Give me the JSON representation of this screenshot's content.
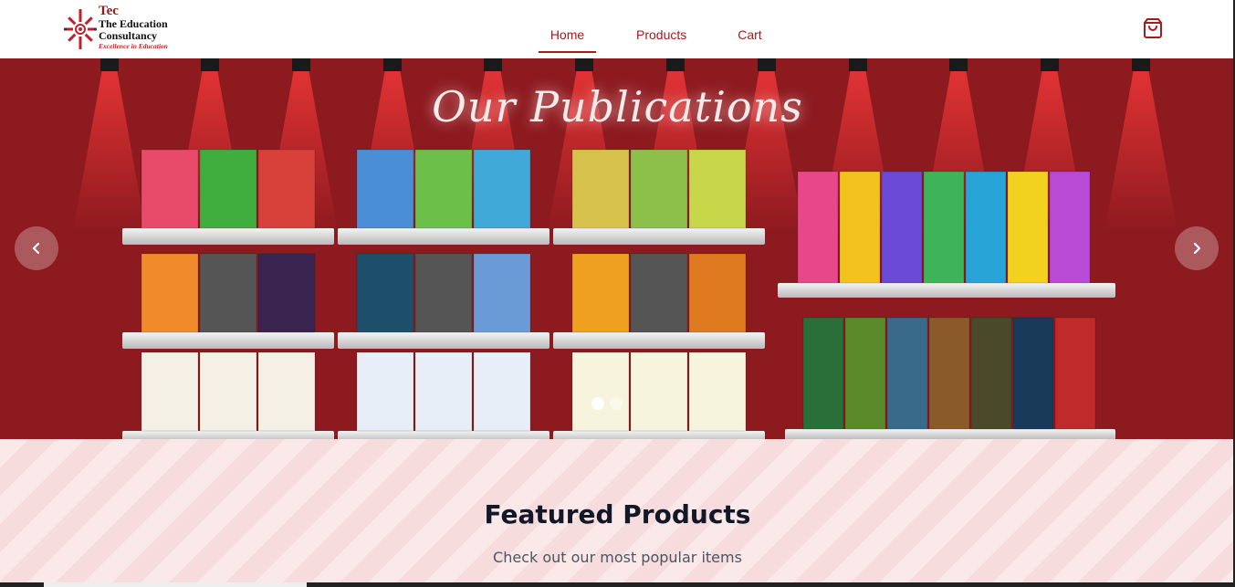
{
  "brand": {
    "name": "Tec",
    "line1": "The Education",
    "line2": "Consultancy",
    "tagline": "Excellence in Education",
    "color": "#a61b1b"
  },
  "nav": {
    "items": [
      {
        "label": "Home",
        "active": true
      },
      {
        "label": "Products",
        "active": false
      },
      {
        "label": "Cart",
        "active": false
      }
    ],
    "cart_icon": "shopping-bag-icon"
  },
  "hero": {
    "title": "Our Publications",
    "background": "#8d1a1f",
    "prev_icon": "chevron-left-icon",
    "next_icon": "chevron-right-icon",
    "active_slide": 1,
    "slide_count": 2
  },
  "featured": {
    "title": "Featured Products",
    "subtitle": "Check out our most popular items"
  }
}
